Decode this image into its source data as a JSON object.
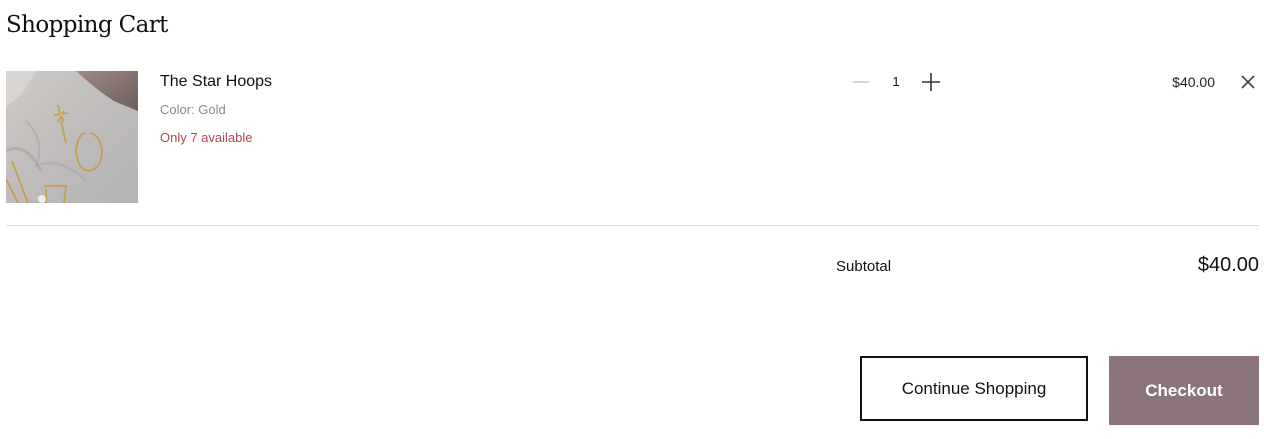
{
  "cart": {
    "title": "Shopping Cart",
    "items": [
      {
        "name": "The Star Hoops",
        "variant": "Color: Gold",
        "stock_note": "Only 7 available",
        "quantity": "1",
        "price": "$40.00"
      }
    ],
    "subtotal_label": "Subtotal",
    "subtotal_value": "$40.00",
    "continue_label": "Continue Shopping",
    "checkout_label": "Checkout"
  },
  "icons": {
    "decrease": "minus-icon",
    "increase": "plus-icon",
    "remove": "close-icon"
  },
  "colors": {
    "checkout_bg": "#8b747e",
    "stock_warning": "#b2494e",
    "muted_text": "#8a8a8a"
  }
}
